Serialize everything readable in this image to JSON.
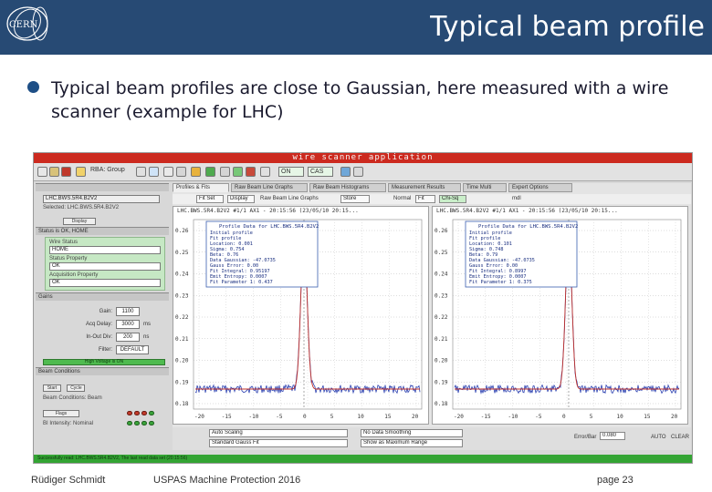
{
  "header": {
    "title": "Typical beam profile",
    "logo_text": "CERN",
    "background_color": "#274a74"
  },
  "bullet": {
    "text": "Typical beam profiles are close to Gaussian, here measured with a wire scanner (example for LHC)"
  },
  "app": {
    "window_title": "wire scanner application",
    "toolbar": {
      "rba_group": "RBA: Group",
      "field1": "ON",
      "field2": "CAS"
    },
    "left": {
      "device_select": "LHC.BWS.5R4.B2V2",
      "selected_label": "Selected: LHC.BWS.5R4.B2V2",
      "sub_button": "Display",
      "status_header": "Status is OK, HOME",
      "wire_status_label": "Wire Status",
      "wire_status_value": "HOME",
      "status_property_label": "Status Property",
      "status_property_value": "OK",
      "acq_property_label": "Acquisition Property",
      "acq_property_value": "OK",
      "gains_header": "Gains",
      "gains": [
        {
          "label": "Gain:",
          "value": "1100",
          "unit": ""
        },
        {
          "label": "Acq Delay:",
          "value": "3000",
          "unit": "ms"
        },
        {
          "label": "In-Out Div:",
          "value": "200",
          "unit": "ns"
        },
        {
          "label": "Filter:",
          "value": "DEFAULT",
          "unit": ""
        }
      ],
      "green_button": "High Voltage is ON",
      "beam_header": "Beam Conditions",
      "beam_tabs": [
        "Start",
        "Cycle"
      ],
      "beam_cond_label": "Beam Conditions: Beam",
      "flags_label": "Flags",
      "intensity_label": "BI Intensity: Nominal"
    },
    "tabs": [
      "Profiles & Fits",
      "Raw Beam Line Graphs",
      "Raw Beam Histograms",
      "Measurement Results",
      "Time Multi",
      "Expert Options"
    ],
    "subtool": {
      "btn1": "Fit Set",
      "btn2": "Display",
      "label1": "Raw Beam Line Graphs",
      "btn3": "Store",
      "label2": "Normal",
      "btn4": "Fit",
      "btn5": "Chi-Sq",
      "label3": "mdl"
    },
    "plots": [
      {
        "title": "LHC.BWS.5R4.B2V2 #1/1 AX1 - 20:15:56 (23/05/10 20:15...",
        "legend_title": "Profile Data for LHC.BWS.5R4.B2V2",
        "legend_lines": [
          "Initial profile",
          "Fit profile",
          "Location: 0.001",
          "Sigma: 0.754",
          "Beta: 0.76",
          "Data Gaussian: -47.0735",
          "Gauss Error: 0.00",
          "Fit Integral: 0.95197",
          "Emit Entropy: 0.0007",
          "Fit Parameter 1: 0.437"
        ],
        "y_ticks": [
          "0.26",
          "0.25",
          "0.24",
          "0.23",
          "0.22",
          "0.21",
          "0.20",
          "0.19",
          "0.18"
        ],
        "x_ticks": [
          "-20",
          "-15",
          "-10",
          "-5",
          "0",
          "5",
          "10",
          "15",
          "20"
        ]
      },
      {
        "title": "LHC.BWS.5R4.B2V2 #1/1 AX1 - 20:15:56 (23/05/10 20:15...",
        "legend_title": "Profile Data for LHC.BWS.5R4.B2V2",
        "legend_lines": [
          "Initial profile",
          "Fit profile",
          "Location: 0.101",
          "Sigma: 0.748",
          "Beta: 0.79",
          "Data Gaussian: -47.0735",
          "Gauss Error: 0.00",
          "Fit Integral: 0.8997",
          "Emit Entropy: 0.0007",
          "Fit Parameter 1: 0.375"
        ],
        "y_ticks": [
          "0.26",
          "0.25",
          "0.24",
          "0.23",
          "0.22",
          "0.21",
          "0.20",
          "0.19",
          "0.18"
        ],
        "x_ticks": [
          "-20",
          "-15",
          "-10",
          "-5",
          "0",
          "5",
          "10",
          "15",
          "20"
        ]
      }
    ],
    "controls": {
      "scaling": "Auto Scaling",
      "smoothing": "No Data Smoothing",
      "fit_select": "Standard Gauss Fit",
      "range_select": "Show as Maximum Range",
      "error_label": "Error/Bar",
      "error_value": "0.080",
      "auto_label": "AUTO",
      "clear_label": "CLEAR"
    },
    "status_text": "Successfully read: LHC.BWS.5R4.B2V2, The last read data set (20:15:56)"
  },
  "footer": {
    "author": "Rüdiger Schmidt",
    "event": "USPAS Machine Protection 2016",
    "page": "page 23"
  }
}
